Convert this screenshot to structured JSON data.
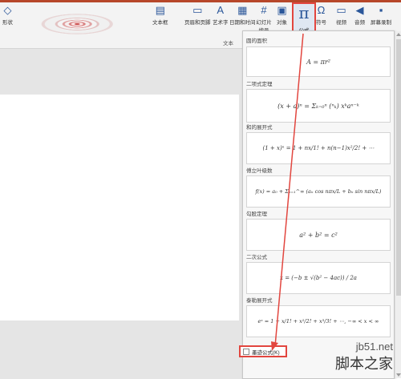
{
  "ribbon": {
    "left_label": "形状",
    "buttons": {
      "textbox": "文本框",
      "header_footer": "页眉和页脚",
      "wordart": "艺术字",
      "datetime": "日期和时间",
      "slide_number": "幻灯片编号",
      "object": "对象",
      "formula": "公式",
      "symbol": "符号",
      "video": "视频",
      "audio": "音频",
      "screen_record": "屏幕录制"
    },
    "group_text": "文本"
  },
  "panel": {
    "items": [
      {
        "title": "圆的面积",
        "formula": "A = πr²"
      },
      {
        "title": "二项式定理",
        "formula": "(x + a)ⁿ = Σₖ₌₀ⁿ (ⁿₖ) xᵏaⁿ⁻ᵏ"
      },
      {
        "title": "和的展开式",
        "formula": "(1 + x)ⁿ = 1 + nx/1! + n(n−1)x²/2! + ⋯"
      },
      {
        "title": "傅立叶级数",
        "formula": "f(x) = a₀ + Σₙ₌₁^∞ (aₙ cos nπx/L + bₙ sin nπx/L)"
      },
      {
        "title": "勾股定理",
        "formula": "a² + b² = c²"
      },
      {
        "title": "二次公式",
        "formula": "x = (−b ± √(b² − 4ac)) / 2a"
      },
      {
        "title": "泰勒展开式",
        "formula": "eˣ = 1 + x/1! + x²/2! + x³/3! + ⋯,   −∞ < x < ∞"
      }
    ],
    "insert_label": "墨迹公式(K)"
  },
  "watermark": {
    "site": "jb51.net",
    "brand": "脚本之家"
  }
}
